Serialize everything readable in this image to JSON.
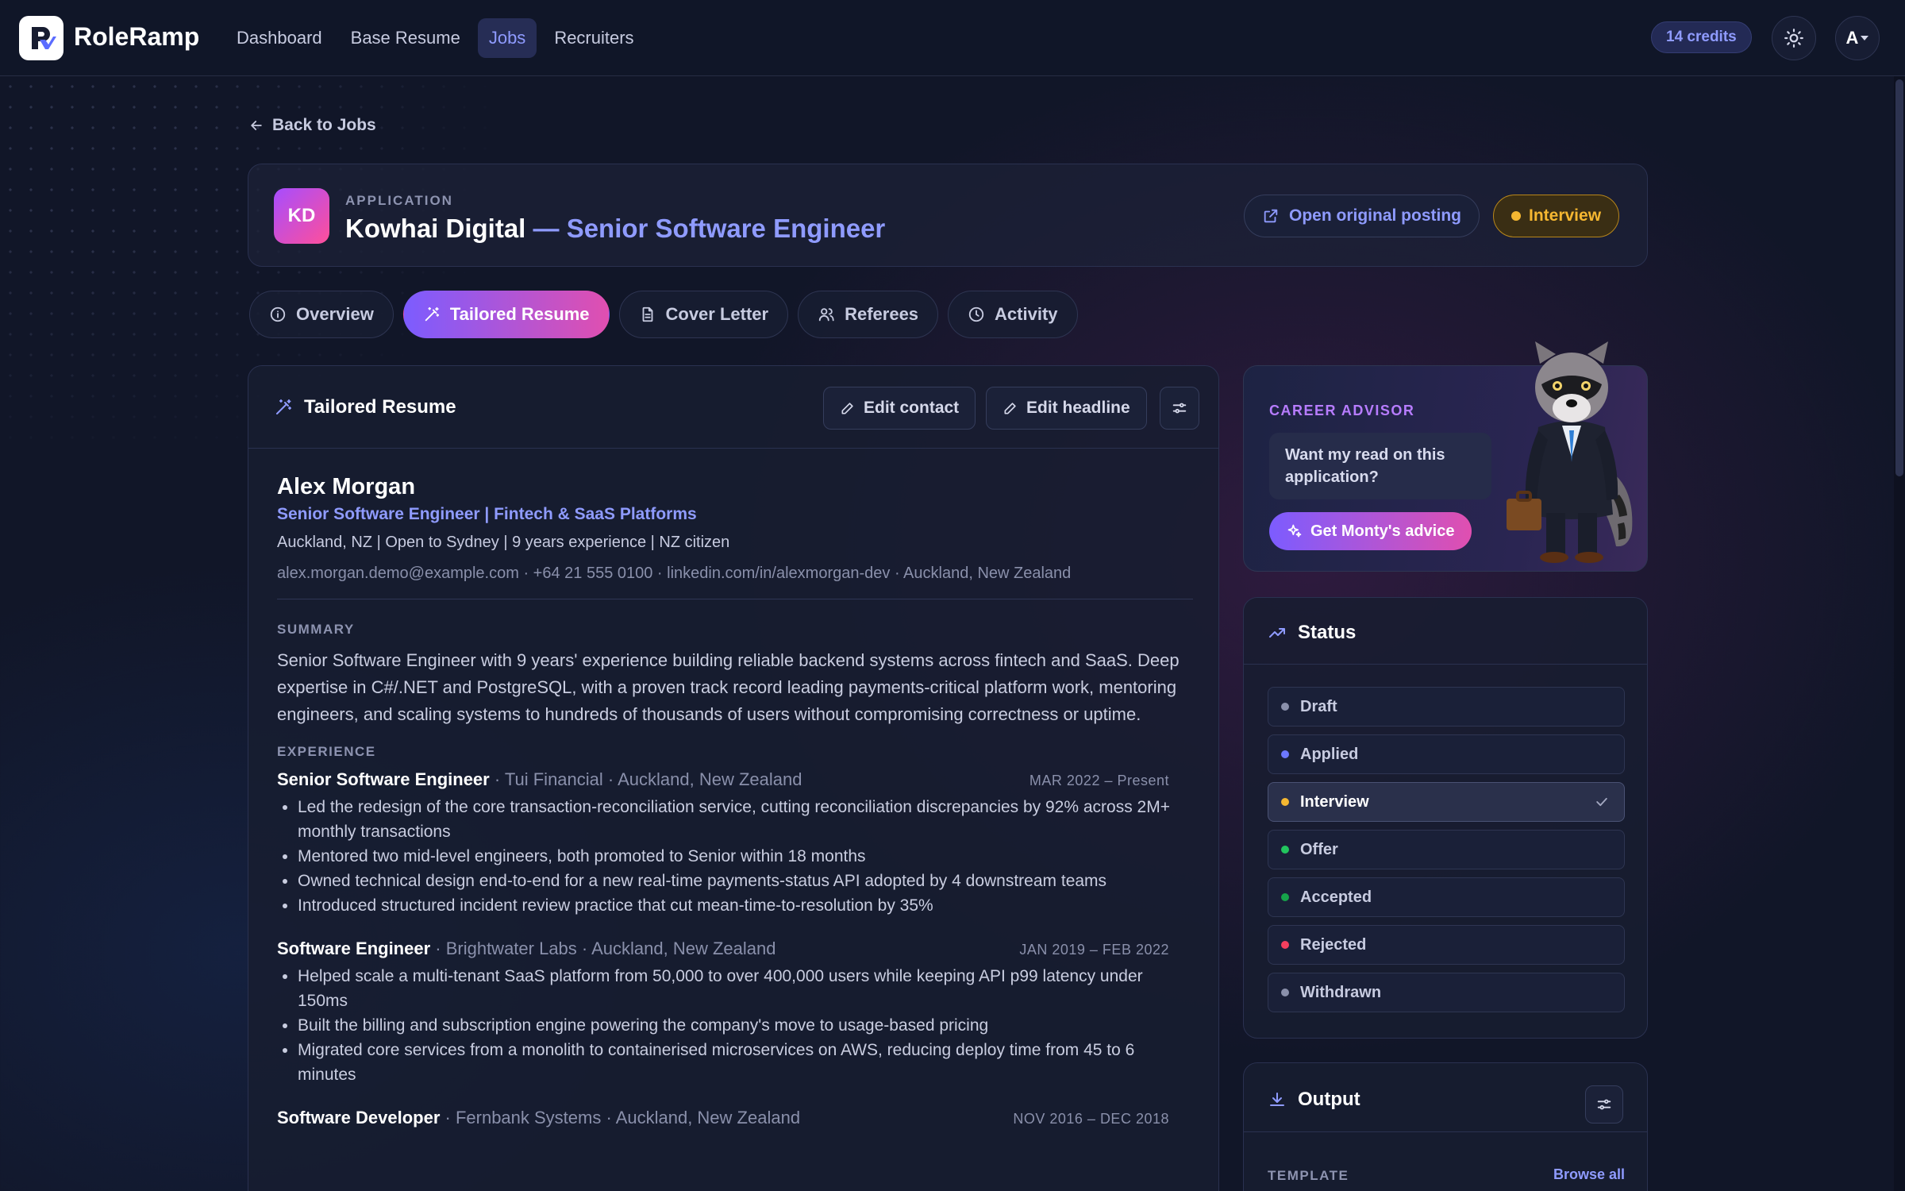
{
  "brand": {
    "name": "RoleRamp"
  },
  "nav": {
    "items": [
      "Dashboard",
      "Base Resume",
      "Jobs",
      "Recruiters"
    ],
    "active": "Jobs"
  },
  "topbar": {
    "credits": "14 credits",
    "avatar_initial": "A"
  },
  "back_link": "Back to Jobs",
  "application": {
    "label": "APPLICATION",
    "initials": "KD",
    "company": "Kowhai Digital",
    "separator": " — ",
    "role": "Senior Software Engineer",
    "open_posting": "Open original posting",
    "status": "Interview"
  },
  "tabs": [
    "Overview",
    "Tailored Resume",
    "Cover Letter",
    "Referees",
    "Activity"
  ],
  "resume_panel": {
    "title": "Tailored Resume",
    "edit_contact": "Edit contact",
    "edit_headline": "Edit headline"
  },
  "resume": {
    "name": "Alex Morgan",
    "headline": "Senior Software Engineer | Fintech & SaaS Platforms",
    "subline": "Auckland, NZ | Open to Sydney | 9 years experience | NZ citizen",
    "contact": "alex.morgan.demo@example.com · +64 21 555 0100 · linkedin.com/in/alexmorgan-dev · Auckland, New Zealand",
    "summary_label": "SUMMARY",
    "summary": "Senior Software Engineer with 9 years' experience building reliable backend systems across fintech and SaaS. Deep expertise in C#/.NET and PostgreSQL, with a proven track record leading payments-critical platform work, mentoring engineers, and scaling systems to hundreds of thousands of users without compromising correctness or uptime.",
    "experience_label": "EXPERIENCE",
    "jobs": [
      {
        "title": "Senior Software Engineer",
        "org": " · Tui Financial · Auckland, New Zealand",
        "dates": "MAR 2022 – Present",
        "bullets": [
          "Led the redesign of the core transaction-reconciliation service, cutting reconciliation discrepancies by 92% across 2M+ monthly transactions",
          "Mentored two mid-level engineers, both promoted to Senior within 18 months",
          "Owned technical design end-to-end for a new real-time payments-status API adopted by 4 downstream teams",
          "Introduced structured incident review practice that cut mean-time-to-resolution by 35%"
        ]
      },
      {
        "title": "Software Engineer",
        "org": " · Brightwater Labs · Auckland, New Zealand",
        "dates": "JAN 2019 – FEB 2022",
        "bullets": [
          "Helped scale a multi-tenant SaaS platform from 50,000 to over 400,000 users while keeping API p99 latency under 150ms",
          "Built the billing and subscription engine powering the company's move to usage-based pricing",
          "Migrated core services from a monolith to containerised microservices on AWS, reducing deploy time from 45 to 6 minutes"
        ]
      },
      {
        "title": "Software Developer",
        "org": " · Fernbank Systems · Auckland, New Zealand",
        "dates": "NOV 2016 – DEC 2018",
        "bullets": []
      }
    ]
  },
  "advisor": {
    "label": "CAREER ADVISOR",
    "prompt": "Want my read on this application?",
    "button": "Get Monty's advice"
  },
  "status_card": {
    "title": "Status",
    "options": [
      {
        "label": "Draft",
        "color": "#8a90ab"
      },
      {
        "label": "Applied",
        "color": "#6d78ff"
      },
      {
        "label": "Interview",
        "color": "#f5b731"
      },
      {
        "label": "Offer",
        "color": "#22c55e"
      },
      {
        "label": "Accepted",
        "color": "#16a34a"
      },
      {
        "label": "Rejected",
        "color": "#f43f5e"
      },
      {
        "label": "Withdrawn",
        "color": "#8a90ab"
      }
    ],
    "selected": "Interview"
  },
  "output_card": {
    "title": "Output",
    "template_label": "TEMPLATE",
    "browse_all": "Browse all"
  },
  "colors": {
    "accent": "#8f9bff",
    "interview": "#f5b731",
    "gradient_start": "#7c5cff",
    "gradient_end": "#e04fb0"
  }
}
